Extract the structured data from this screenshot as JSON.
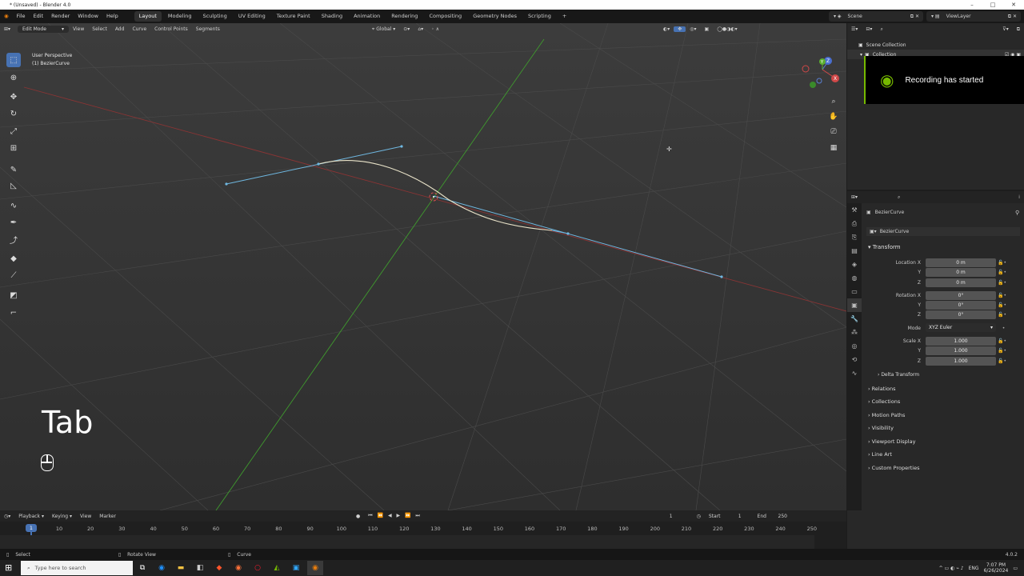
{
  "window": {
    "title": "* (Unsaved) - Blender 4.0"
  },
  "menus": [
    "File",
    "Edit",
    "Render",
    "Window",
    "Help"
  ],
  "workspaces": [
    "Layout",
    "Modeling",
    "Sculpting",
    "UV Editing",
    "Texture Paint",
    "Shading",
    "Animation",
    "Rendering",
    "Compositing",
    "Geometry Nodes",
    "Scripting"
  ],
  "scene": {
    "name": "Scene",
    "view_layer": "ViewLayer"
  },
  "viewport": {
    "mode": "Edit Mode",
    "menus": [
      "View",
      "Select",
      "Add",
      "Curve",
      "Control Points",
      "Segments"
    ],
    "orientation": "Global",
    "perspective": "User Perspective",
    "object_line": "(1) BezierCurve",
    "key_overlay": "Tab"
  },
  "outliner": {
    "scene_collection": "Scene Collection",
    "collection": "Collection"
  },
  "notification": {
    "text": "Recording has started"
  },
  "properties": {
    "object_name": "BezierCurve",
    "data_name": "BezierCurve",
    "transform_label": "Transform",
    "location": {
      "label_x": "Location X",
      "label_y": "Y",
      "label_z": "Z",
      "x": "0 m",
      "y": "0 m",
      "z": "0 m"
    },
    "rotation": {
      "label_x": "Rotation X",
      "label_y": "Y",
      "label_z": "Z",
      "x": "0°",
      "y": "0°",
      "z": "0°"
    },
    "mode": {
      "label": "Mode",
      "value": "XYZ Euler"
    },
    "scale": {
      "label_x": "Scale X",
      "label_y": "Y",
      "label_z": "Z",
      "x": "1.000",
      "y": "1.000",
      "z": "1.000"
    },
    "delta_transform": "Delta Transform",
    "sections": [
      "Relations",
      "Collections",
      "Motion Paths",
      "Visibility",
      "Viewport Display",
      "Line Art",
      "Custom Properties"
    ]
  },
  "timeline": {
    "menus": [
      "Playback",
      "Keying",
      "View",
      "Marker"
    ],
    "current_frame": "1",
    "start_label": "Start",
    "start": "1",
    "end_label": "End",
    "end": "250",
    "ticks": [
      "10",
      "20",
      "30",
      "40",
      "50",
      "60",
      "70",
      "80",
      "90",
      "100",
      "110",
      "120",
      "130",
      "140",
      "150",
      "160",
      "170",
      "180",
      "190",
      "200",
      "210",
      "220",
      "230",
      "240",
      "250"
    ],
    "cursor_label": "1"
  },
  "statusbar": {
    "select": "Select",
    "rotate": "Rotate View",
    "curve": "Curve",
    "version": "4.0.2"
  },
  "taskbar": {
    "search_placeholder": "Type here to search",
    "lang": "ENG",
    "time": "7:07 PM",
    "date": "6/26/2024"
  },
  "colors": {
    "accent": "#4772b3",
    "curve_handle": "#6fb7e0",
    "curve": "#e8e2c8",
    "x_axis": "#a33a3a",
    "y_axis": "#3f9a2e",
    "notif_green": "#76b900"
  }
}
